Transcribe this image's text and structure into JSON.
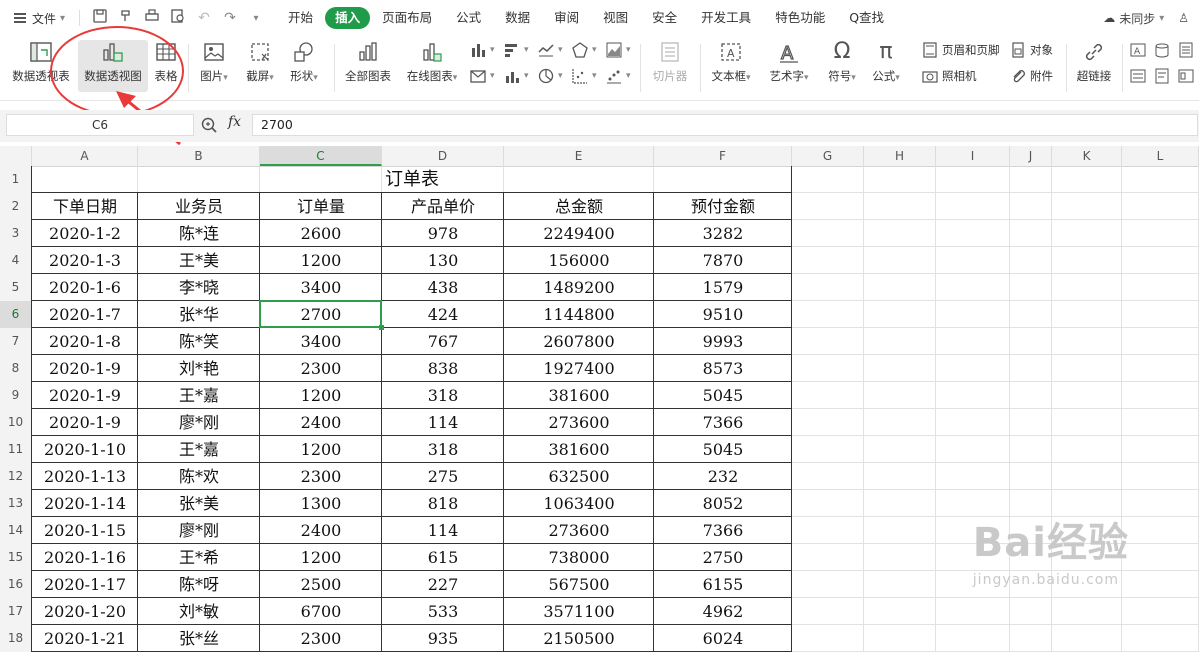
{
  "menu": {
    "file_label": "文件",
    "tabs": [
      {
        "label": "开始"
      },
      {
        "label": "插入",
        "active": true
      },
      {
        "label": "页面布局"
      },
      {
        "label": "公式"
      },
      {
        "label": "数据"
      },
      {
        "label": "审阅"
      },
      {
        "label": "视图"
      },
      {
        "label": "安全"
      },
      {
        "label": "开发工具"
      },
      {
        "label": "特色功能"
      },
      {
        "label": "Q查找"
      }
    ],
    "sync_label": "未同步"
  },
  "ribbon": {
    "pivot_table": "数据透视表",
    "pivot_chart": "数据透视图",
    "table": "表格",
    "picture": "图片",
    "screenshot": "截屏",
    "shape": "形状",
    "all_charts": "全部图表",
    "online_charts": "在线图表",
    "slicer": "切片器",
    "textbox": "文本框",
    "wordart": "艺术字",
    "symbol": "符号",
    "formula": "公式",
    "header_footer": "页眉和页脚",
    "object": "对象",
    "camera": "照相机",
    "attachment": "附件",
    "hyperlink": "超链接"
  },
  "formula_bar": {
    "name_box": "C6",
    "fx_label": "fx",
    "value": "2700"
  },
  "sheet": {
    "columns": [
      "A",
      "B",
      "C",
      "D",
      "E",
      "F",
      "G",
      "H",
      "I",
      "J",
      "K",
      "L"
    ],
    "rows": [
      "1",
      "2",
      "3",
      "4",
      "5",
      "6",
      "7",
      "8",
      "9",
      "10",
      "11",
      "12",
      "13",
      "14",
      "15",
      "16",
      "17",
      "18"
    ],
    "selected_cell": "C6",
    "title": "订单表",
    "headers": [
      "下单日期",
      "业务员",
      "订单量",
      "产品单价",
      "总金额",
      "预付金额"
    ],
    "data": [
      [
        "2020-1-2",
        "陈*连",
        "2600",
        "978",
        "2249400",
        "3282"
      ],
      [
        "2020-1-3",
        "王*美",
        "1200",
        "130",
        "156000",
        "7870"
      ],
      [
        "2020-1-6",
        "李*晓",
        "3400",
        "438",
        "1489200",
        "1579"
      ],
      [
        "2020-1-7",
        "张*华",
        "2700",
        "424",
        "1144800",
        "9510"
      ],
      [
        "2020-1-8",
        "陈*笑",
        "3400",
        "767",
        "2607800",
        "9993"
      ],
      [
        "2020-1-9",
        "刘*艳",
        "2300",
        "838",
        "1927400",
        "8573"
      ],
      [
        "2020-1-9",
        "王*嘉",
        "1200",
        "318",
        "381600",
        "5045"
      ],
      [
        "2020-1-9",
        "廖*刚",
        "2400",
        "114",
        "273600",
        "7366"
      ],
      [
        "2020-1-10",
        "王*嘉",
        "1200",
        "318",
        "381600",
        "5045"
      ],
      [
        "2020-1-13",
        "陈*欢",
        "2300",
        "275",
        "632500",
        "232"
      ],
      [
        "2020-1-14",
        "张*美",
        "1300",
        "818",
        "1063400",
        "8052"
      ],
      [
        "2020-1-15",
        "廖*刚",
        "2400",
        "114",
        "273600",
        "7366"
      ],
      [
        "2020-1-16",
        "王*希",
        "1200",
        "615",
        "738000",
        "2750"
      ],
      [
        "2020-1-17",
        "陈*呀",
        "2500",
        "227",
        "567500",
        "6155"
      ],
      [
        "2020-1-20",
        "刘*敏",
        "6700",
        "533",
        "3571100",
        "4962"
      ],
      [
        "2020-1-21",
        "张*丝",
        "2300",
        "935",
        "2150500",
        "6024"
      ]
    ]
  },
  "watermark": {
    "brand": "Bai经验",
    "url": "jingyan.baidu.com"
  }
}
